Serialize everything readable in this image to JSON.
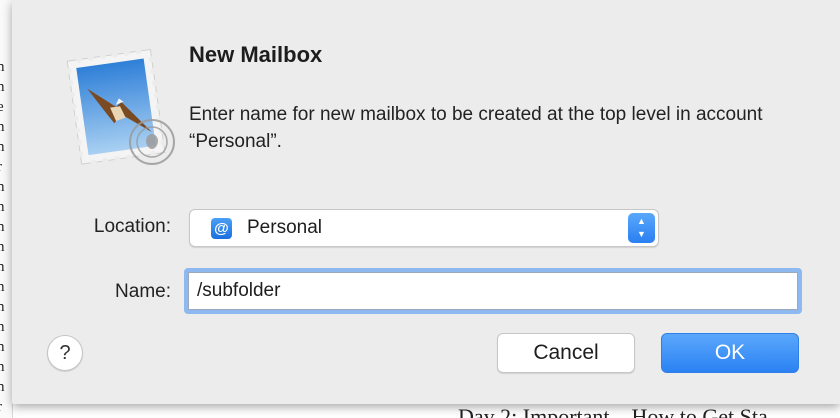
{
  "dialog": {
    "title": "New Mailbox",
    "message": "Enter name for new mailbox to be created at the top level in account “Personal”."
  },
  "location": {
    "label": "Location:",
    "selected_value": "Personal",
    "account_icon": "at-sign-icon"
  },
  "name": {
    "label": "Name:",
    "value": "/subfolder"
  },
  "buttons": {
    "help_label": "?",
    "cancel_label": "Cancel",
    "ok_label": "OK"
  },
  "background": {
    "bottom_text": "Day 2: Important – How to Get Sta",
    "left_fragments": [
      "n",
      "n",
      "e",
      "n",
      "n",
      "r",
      "n",
      "n",
      "n",
      "n",
      "n",
      "n",
      "n",
      "n",
      "n",
      "n",
      "n",
      "r"
    ]
  },
  "colors": {
    "accent": "#2b82f3",
    "sheet_background": "#ececec",
    "focus_ring": "#8db8f0"
  }
}
